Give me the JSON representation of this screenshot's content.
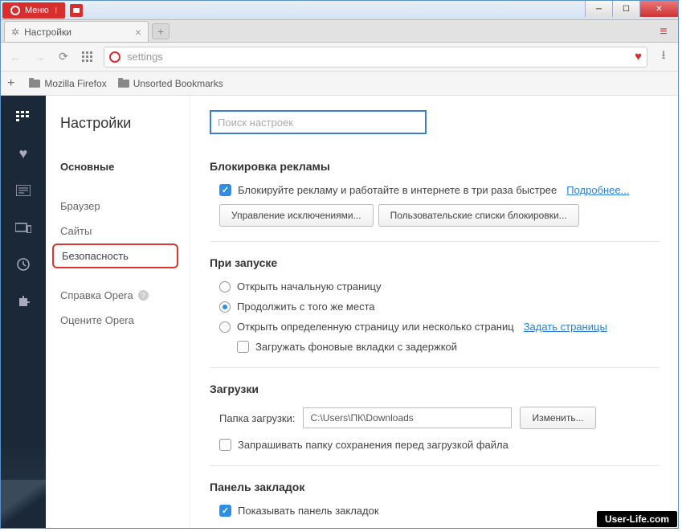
{
  "titlebar": {
    "menu": "Меню"
  },
  "tab": {
    "title": "Настройки"
  },
  "addressbar": {
    "url": "settings"
  },
  "bookmarks": {
    "items": [
      "Mozilla Firefox",
      "Unsorted Bookmarks"
    ]
  },
  "sidebar": {
    "title": "Настройки",
    "main": "Основные",
    "items": [
      "Браузер",
      "Сайты",
      "Безопасность"
    ],
    "help": "Справка Opera",
    "rate": "Оцените Opera"
  },
  "search": {
    "placeholder": "Поиск настроек"
  },
  "adblock": {
    "title": "Блокировка рекламы",
    "label": "Блокируйте рекламу и работайте в интернете в три раза быстрее",
    "more": "Подробнее...",
    "btn1": "Управление исключениями...",
    "btn2": "Пользовательские списки блокировки..."
  },
  "startup": {
    "title": "При запуске",
    "opt1": "Открыть начальную страницу",
    "opt2": "Продолжить с того же места",
    "opt3": "Открыть определенную страницу или несколько страниц",
    "opt3link": "Задать страницы",
    "opt4": "Загружать фоновые вкладки с задержкой"
  },
  "downloads": {
    "title": "Загрузки",
    "label": "Папка загрузки:",
    "path": "C:\\Users\\ПК\\Downloads",
    "change": "Изменить...",
    "ask": "Запрашивать папку сохранения перед загрузкой файла"
  },
  "bookmarkbar": {
    "title": "Панель закладок",
    "show": "Показывать панель закладок"
  },
  "watermark": "User-Life.com"
}
